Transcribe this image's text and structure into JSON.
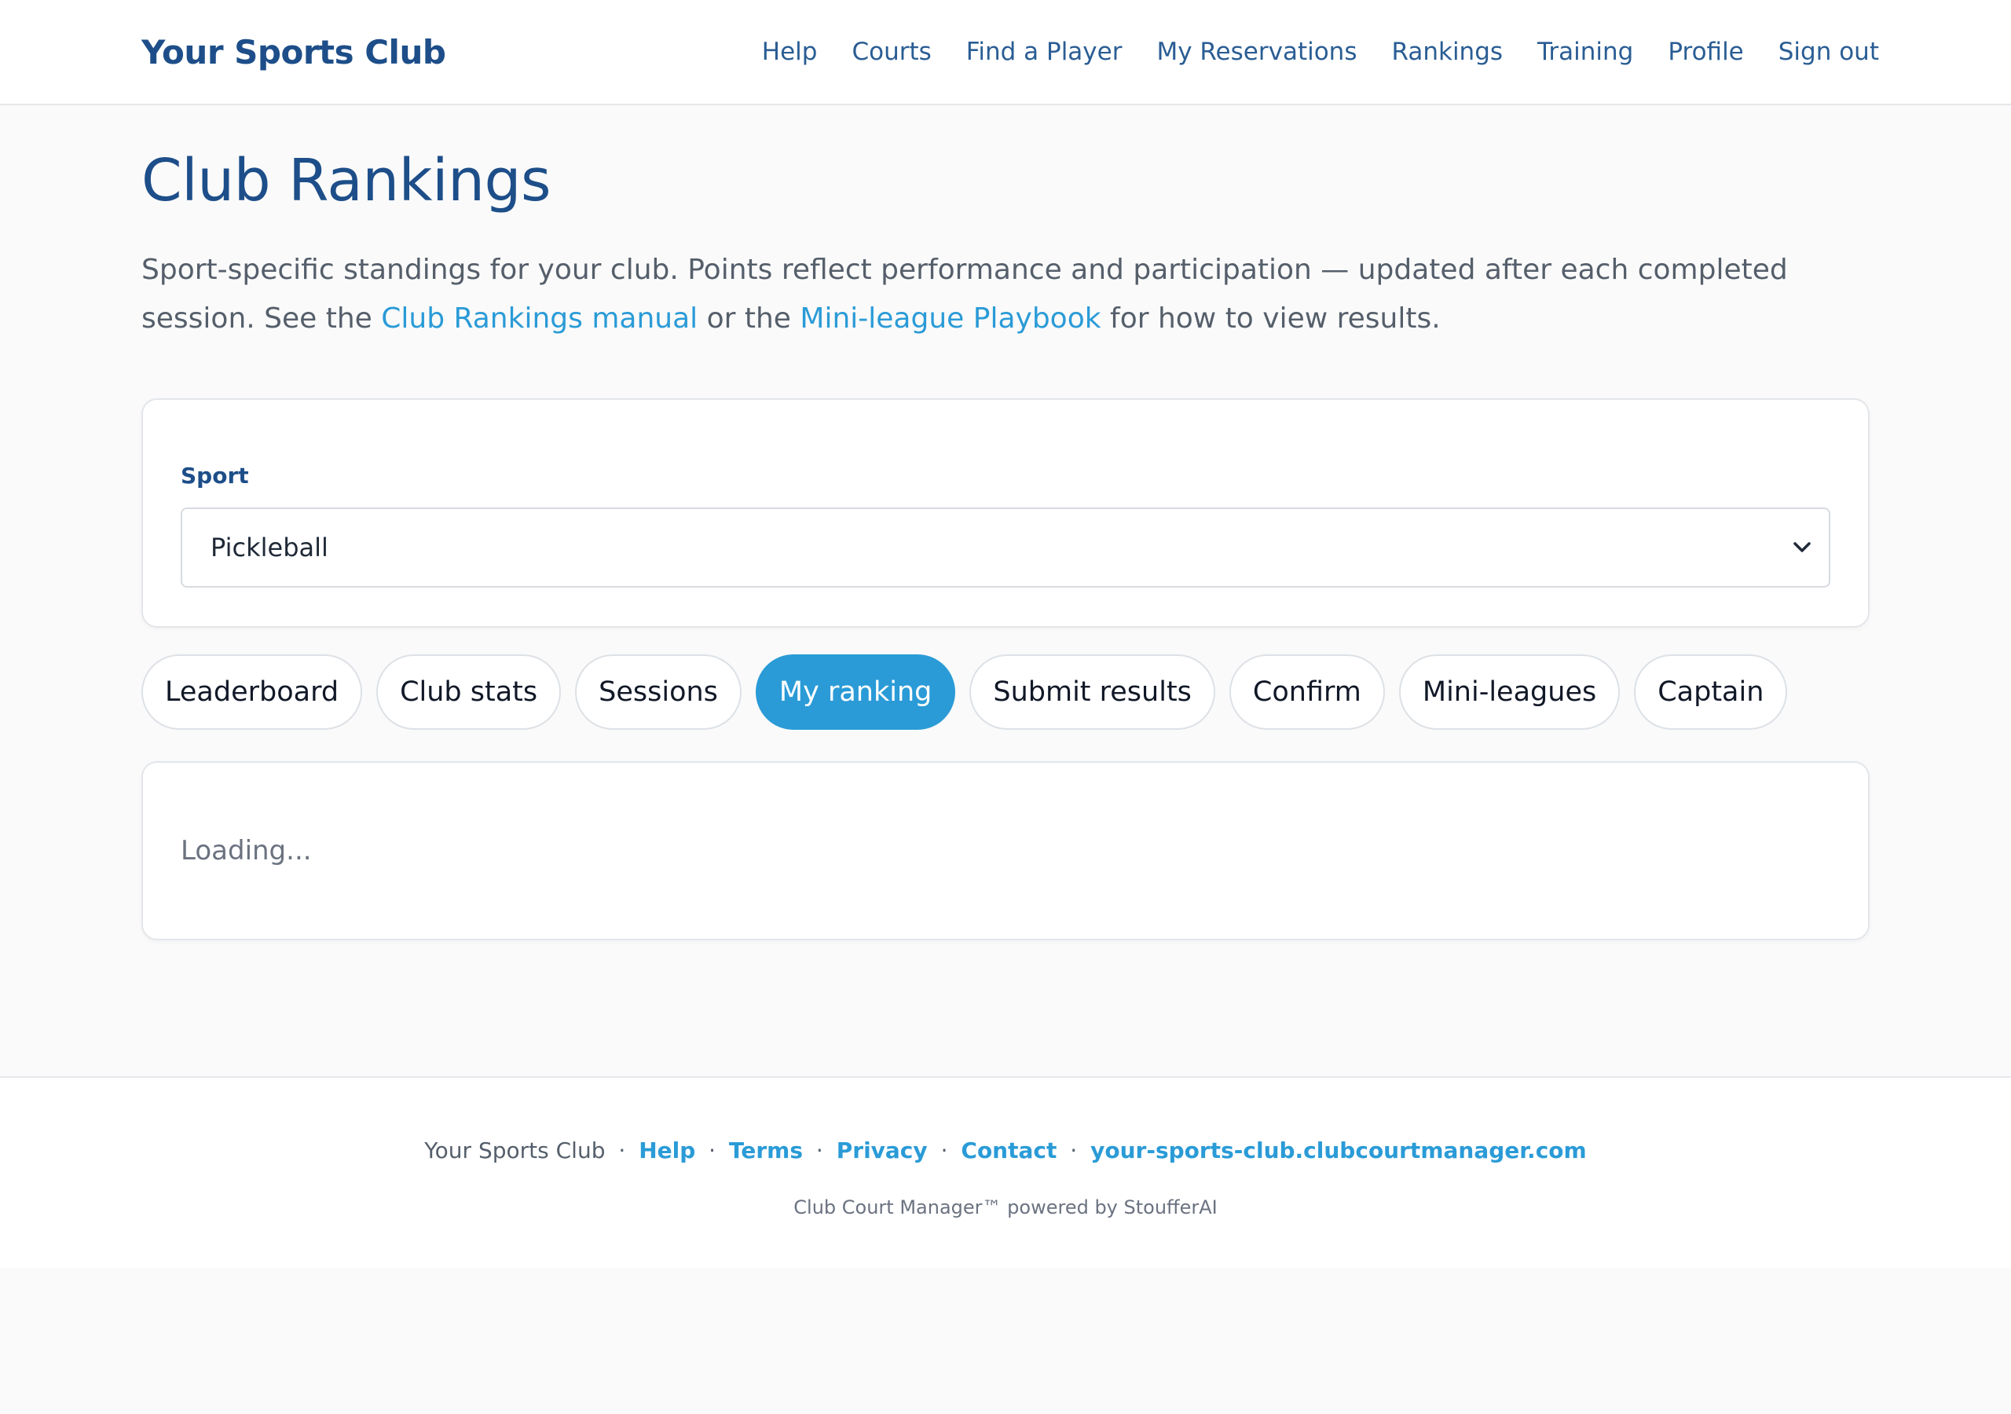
{
  "header": {
    "brand": "Your Sports Club",
    "nav": [
      "Help",
      "Courts",
      "Find a Player",
      "My Reservations",
      "Rankings",
      "Training",
      "Profile",
      "Sign out"
    ]
  },
  "main": {
    "title": "Club Rankings",
    "intro_part1": "Sport-specific standings for your club. Points reflect performance and participation — updated after each completed session. See the ",
    "intro_link1": "Club Rankings manual",
    "intro_part2": " or the ",
    "intro_link2": "Mini-league Playbook",
    "intro_part3": " for how to view results.",
    "sport_label": "Sport",
    "sport_value": "Pickleball",
    "tabs": [
      "Leaderboard",
      "Club stats",
      "Sessions",
      "My ranking",
      "Submit results",
      "Confirm",
      "Mini-leagues",
      "Captain"
    ],
    "active_tab": "My ranking",
    "loading_text": "Loading..."
  },
  "footer": {
    "club_name": "Your Sports Club",
    "separator": "·",
    "links": [
      "Help",
      "Terms",
      "Privacy",
      "Contact",
      "your-sports-club.clubcourtmanager.com"
    ],
    "powered_by": "Club Court Manager™ powered by StoufferAI"
  },
  "colors": {
    "brand": "#1d4e89",
    "accent": "#2a9bd7",
    "background": "#fafafa"
  },
  "icons": {
    "select_chevron": "chevron-down-icon"
  }
}
